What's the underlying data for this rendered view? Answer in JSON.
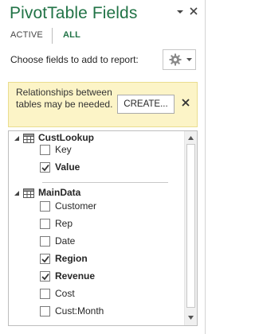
{
  "pane": {
    "title": "PivotTable Fields",
    "tabs": [
      {
        "label": "ACTIVE",
        "active": false
      },
      {
        "label": "ALL",
        "active": true
      }
    ],
    "choose_label": "Choose fields to add to report:"
  },
  "relationship_banner": {
    "message": "Relationships between tables may be needed.",
    "create_label": "CREATE..."
  },
  "groups": [
    {
      "name": "CustLookup",
      "fields": [
        {
          "label": "Key",
          "checked": false
        },
        {
          "label": "Value",
          "checked": true
        }
      ]
    },
    {
      "name": "MainData",
      "fields": [
        {
          "label": "Customer",
          "checked": false
        },
        {
          "label": "Rep",
          "checked": false
        },
        {
          "label": "Date",
          "checked": false
        },
        {
          "label": "Region",
          "checked": true
        },
        {
          "label": "Revenue",
          "checked": true
        },
        {
          "label": "Cost",
          "checked": false
        },
        {
          "label": "Cust:Month",
          "checked": false
        }
      ]
    }
  ],
  "colors": {
    "accent": "#217346",
    "banner_bg": "#fcf4c7"
  }
}
